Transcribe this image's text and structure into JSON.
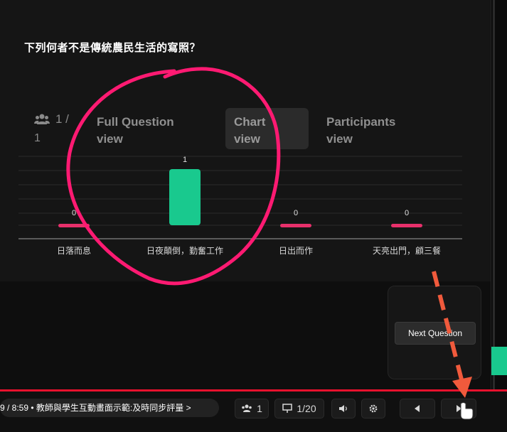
{
  "question": {
    "title": "下列何者不是傳統農民生活的寫照？"
  },
  "tabs": {
    "participants_count_line1": "1 /",
    "participants_count_line2": "1",
    "full_question_line1": "Full Question",
    "full_question_line2": "view",
    "chart_line1": "Chart",
    "chart_line2": "view",
    "participants_line1": "Participants",
    "participants_line2": "view"
  },
  "chart_data": {
    "type": "bar",
    "categories": [
      "日落而息",
      "日夜顛倒，勤奮工作",
      "日出而作",
      "天亮出門，顧三餐"
    ],
    "values": [
      0,
      1,
      0,
      0
    ],
    "data_labels": [
      "0",
      "1",
      "0",
      "0"
    ],
    "title": "",
    "xlabel": "",
    "ylabel": "",
    "ylim": [
      0,
      1
    ],
    "grid": true,
    "highlight_category": "日夜顛倒，勤奮工作",
    "colors": {
      "correct": "#19c98e",
      "incorrect": "#e8306b"
    }
  },
  "next_card": {
    "button_label": "Next Question"
  },
  "player": {
    "time_text": "9 / 8:59 • 教師與學生互動畫面示範:及時同步評量 >",
    "participants": "1",
    "slides": "1/20"
  },
  "annotation_colors": {
    "circle": "#ff1a72",
    "arrow": "#f05a3c"
  }
}
